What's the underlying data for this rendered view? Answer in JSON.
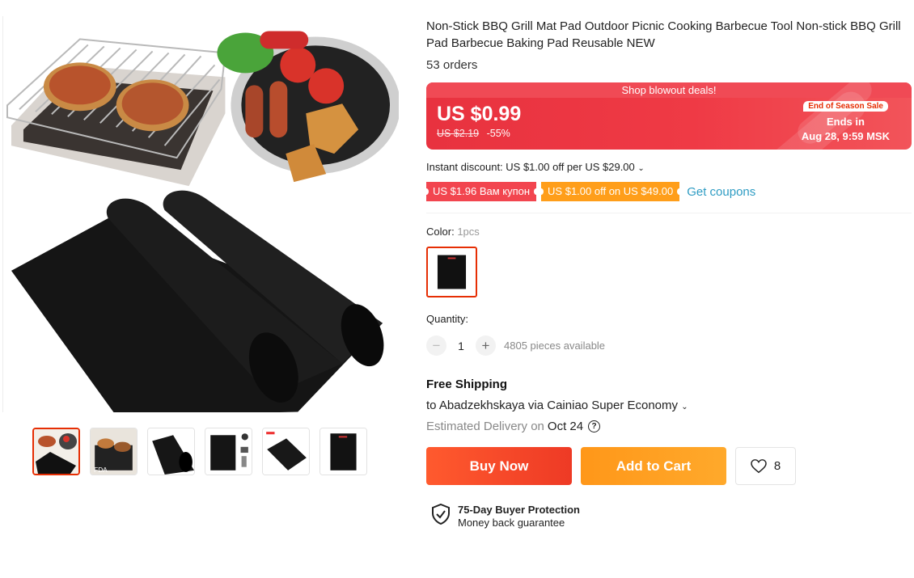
{
  "product": {
    "title": "Non-Stick BBQ Grill Mat Pad Outdoor Picnic Cooking Barbecue Tool Non-stick BBQ Grill Pad Barbecue Baking Pad Reusable NEW",
    "orders": "53 orders"
  },
  "deal": {
    "banner": "Shop blowout deals!",
    "price": "US $0.99",
    "old_price": "US $2.19",
    "discount": "-55%",
    "tag": "End of Season Sale",
    "ends_label": "Ends in",
    "ends_time": "Aug 28, 9:59 MSK",
    "color": "#e8323f"
  },
  "instant_discount": {
    "text": "Instant discount: US $1.00 off per US $29.00",
    "chevron": "⌄"
  },
  "coupons": {
    "items": [
      {
        "label": "US $1.96 Вам купон",
        "color": "#f2454f"
      },
      {
        "label": "US $1.00 off on US $49.00",
        "color": "#ff9e1a"
      }
    ],
    "link": "Get coupons"
  },
  "color": {
    "label": "Color:",
    "value": "1pcs"
  },
  "quantity": {
    "label": "Quantity:",
    "minus": "−",
    "value": "1",
    "plus": "+",
    "available": "4805 pieces available"
  },
  "shipping": {
    "title": "Free Shipping",
    "via": "to Abadzekhskaya via Cainiao Super Economy",
    "chevron": "⌄",
    "estimate_label": "Estimated Delivery on",
    "estimate_date": "Oct 24",
    "help_icon": "?"
  },
  "actions": {
    "buy": "Buy Now",
    "cart": "Add to Cart",
    "wishlist_count": "8",
    "buy_color": "#ee3a25",
    "cart_color": "#ff9719"
  },
  "protection": {
    "title": "75-Day Buyer Protection",
    "subtitle": "Money back guarantee"
  },
  "gallery": {
    "thumbnail_count": 6,
    "selected": 1,
    "thumb_badge": "FDA"
  }
}
